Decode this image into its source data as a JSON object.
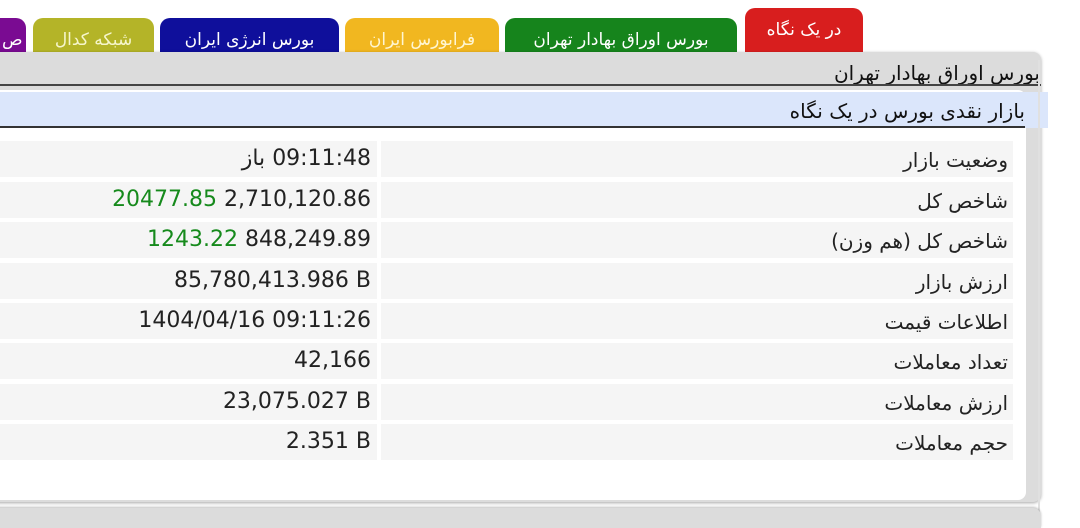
{
  "tabs": [
    {
      "label": "در یک نگاه",
      "active": true,
      "color": "#d81e1e"
    },
    {
      "label": "بورس اوراق بهادار تهران",
      "color": "#16841c"
    },
    {
      "label": "فرابورس ایران",
      "color": "#f1b720"
    },
    {
      "label": "بورس انرژی ایران",
      "color": "#0f0f9b"
    },
    {
      "label": "شبکه کدال",
      "color": "#b4b428"
    },
    {
      "label": "ص",
      "color": "#7a0b92"
    }
  ],
  "panel": {
    "title": "بورس اوراق بهادار تهران"
  },
  "section": {
    "title": "بازار نقدی بورس در یک نگاه"
  },
  "rows": {
    "market_status": {
      "label": "وضعیت بازار",
      "status": "باز",
      "time": "09:11:48"
    },
    "total_index": {
      "label": "شاخص کل",
      "value": "2,710,120.86",
      "change": "20477.85"
    },
    "equal_weight_index": {
      "label": "شاخص کل (هم وزن)",
      "value": "848,249.89",
      "change": "1243.22"
    },
    "market_value": {
      "label": "ارزش بازار",
      "value": "85,780,413.986 B"
    },
    "price_info": {
      "label": "اطلاعات قیمت",
      "value": "1404/04/16 09:11:26"
    },
    "trade_count": {
      "label": "تعداد معاملات",
      "value": "42,166"
    },
    "trade_value": {
      "label": "ارزش معاملات",
      "value": "23,075.027 B"
    },
    "trade_volume": {
      "label": "حجم معاملات",
      "value": "2.351 B"
    }
  },
  "colors": {
    "positive_change": "#168a1c",
    "header_band": "#dbe6fb",
    "panel_gray": "#dcdcdc"
  }
}
